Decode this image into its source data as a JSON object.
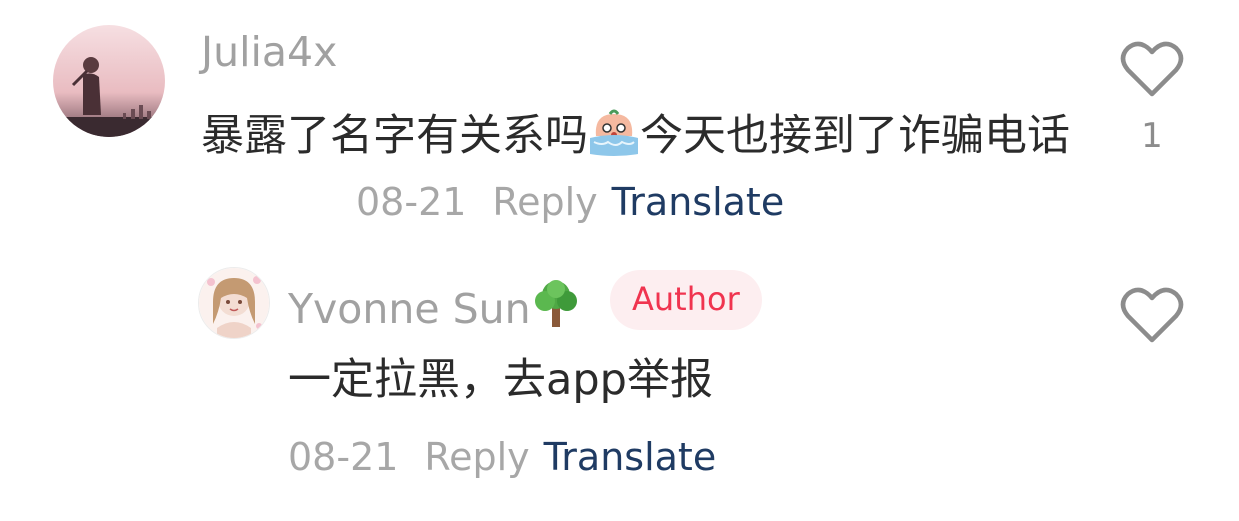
{
  "comments": [
    {
      "username": "Julia4x",
      "text_part1": "暴露了名字有关系吗",
      "text_emoji": "crying-face-emoji",
      "text_part2": "今天也接到了诈骗电话",
      "date": "08-21",
      "reply_label": "Reply",
      "translate_label": "Translate",
      "like_count": "1"
    }
  ],
  "replies": [
    {
      "username": "Yvonne Sun",
      "username_emoji": "tree-emoji",
      "badge": "Author",
      "text": "一定拉黑，去app举报",
      "date": "08-21",
      "reply_label": "Reply",
      "translate_label": "Translate"
    }
  ],
  "colors": {
    "translate": "#1f3b63",
    "author_badge_text": "#f0344f",
    "author_badge_bg": "#fdeef0",
    "muted": "#a7a7a7"
  }
}
